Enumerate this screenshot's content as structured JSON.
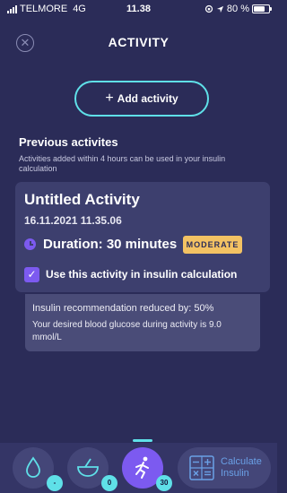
{
  "status": {
    "carrier": "TELMORE",
    "network": "4G",
    "time": "11.38",
    "battery": "80 %"
  },
  "header": {
    "title": "ACTIVITY",
    "close_icon": "close-icon"
  },
  "add_button": {
    "plus": "+",
    "label": "Add activity"
  },
  "previous": {
    "title": "Previous activites",
    "description": "Activities added within 4 hours can be used in your insulin calculation"
  },
  "activity": {
    "name": "Untitled Activity",
    "datetime": "16.11.2021 11.35.06",
    "duration": "Duration: 30 minutes",
    "intensity": "MODERATE",
    "use_label": "Use this activity in insulin calculation",
    "use_checked": true
  },
  "info": {
    "reduction": "Insulin recommendation reduced by: 50%",
    "glucose": "Your desired blood glucose during activity is 9.0 mmol/L"
  },
  "nav": {
    "blood_glucose_count": "-",
    "carbs_count": "0",
    "activity_count": "30",
    "calculate_label": "Calculate\nInsulin"
  },
  "colors": {
    "background": "#2b2c58",
    "card": "#3d3f6e",
    "accent": "#5fe0e8",
    "purple": "#7c5af0",
    "badge": "#f3c263"
  }
}
